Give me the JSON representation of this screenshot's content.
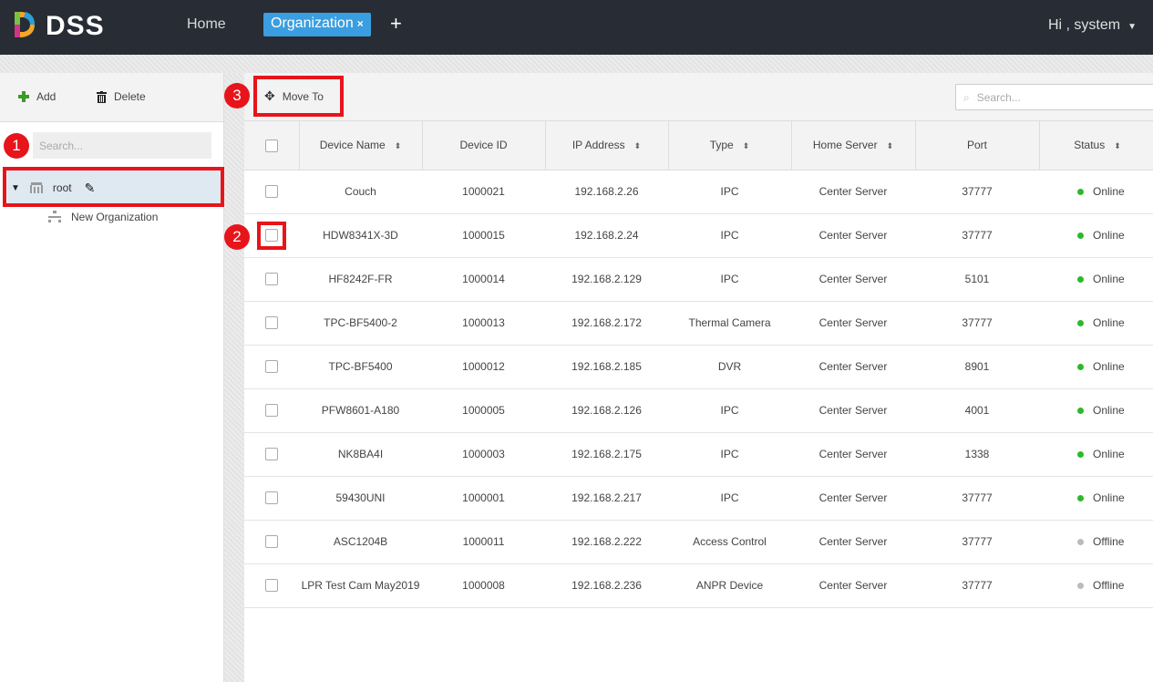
{
  "header": {
    "brand": "DSS",
    "home": "Home",
    "active_tab": "Organization",
    "tab_close": "×",
    "add_tab": "+",
    "user": "Hi , system",
    "caret": "▼"
  },
  "left": {
    "add": "Add",
    "delete": "Delete",
    "search_placeholder": "Search...",
    "root": "root",
    "children": [
      "New Organization"
    ]
  },
  "main": {
    "move_to": "Move To",
    "search_placeholder": "Search...",
    "columns": [
      "Device Name",
      "Device ID",
      "IP Address",
      "Type",
      "Home Server",
      "Port",
      "Status"
    ],
    "rows": [
      [
        "Couch",
        "1000021",
        "192.168.2.26",
        "IPC",
        "Center Server",
        "37777",
        "Online"
      ],
      [
        "HDW8341X-3D",
        "1000015",
        "192.168.2.24",
        "IPC",
        "Center Server",
        "37777",
        "Online"
      ],
      [
        "HF8242F-FR",
        "1000014",
        "192.168.2.129",
        "IPC",
        "Center Server",
        "5101",
        "Online"
      ],
      [
        "TPC-BF5400-2",
        "1000013",
        "192.168.2.172",
        "Thermal Camera",
        "Center Server",
        "37777",
        "Online"
      ],
      [
        "TPC-BF5400",
        "1000012",
        "192.168.2.185",
        "DVR",
        "Center Server",
        "8901",
        "Online"
      ],
      [
        "PFW8601-A180",
        "1000005",
        "192.168.2.126",
        "IPC",
        "Center Server",
        "4001",
        "Online"
      ],
      [
        "NK8BA4I",
        "1000003",
        "192.168.2.175",
        "IPC",
        "Center Server",
        "1338",
        "Online"
      ],
      [
        "59430UNI",
        "1000001",
        "192.168.2.217",
        "IPC",
        "Center Server",
        "37777",
        "Online"
      ],
      [
        "ASC1204B",
        "1000011",
        "192.168.2.222",
        "Access Control",
        "Center Server",
        "37777",
        "Offline"
      ],
      [
        "LPR Test Cam May2019",
        "1000008",
        "192.168.2.236",
        "ANPR Device",
        "Center Server",
        "37777",
        "Offline"
      ]
    ]
  },
  "annotations": [
    "1",
    "2",
    "3"
  ],
  "colors": {
    "online": "#2db82d",
    "offline": "#bbbbbb",
    "accent": "#3a9ee0",
    "highlight": "#e8141b"
  }
}
